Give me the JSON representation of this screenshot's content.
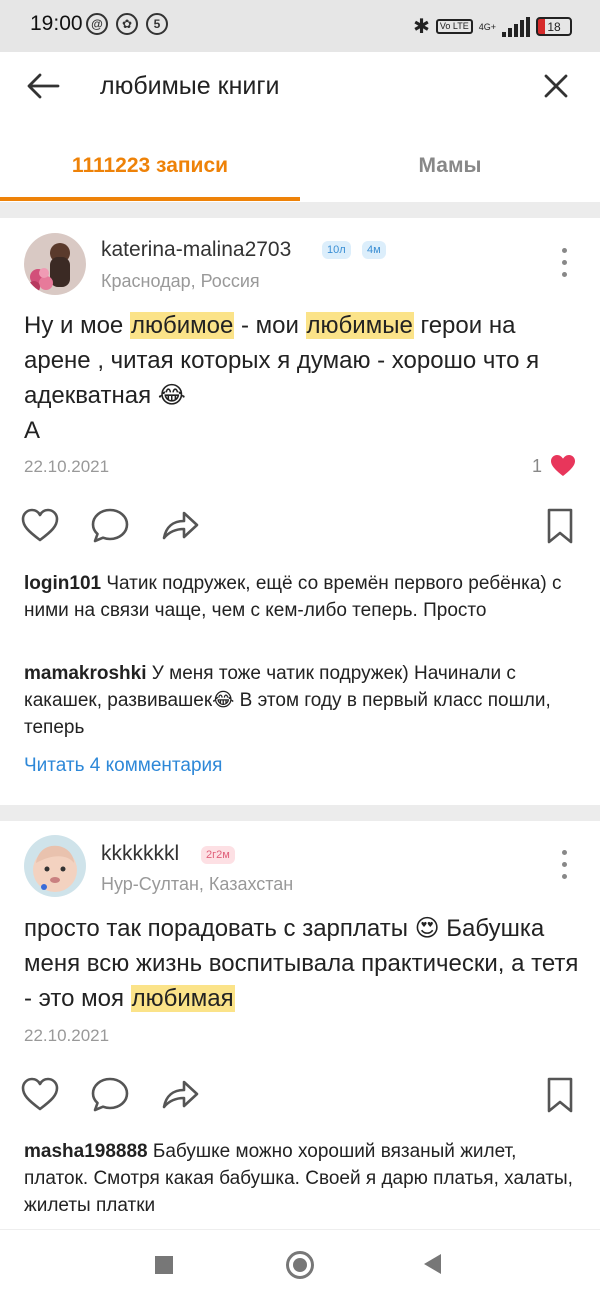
{
  "status": {
    "time": "19:00",
    "icons": [
      "at-icon",
      "gear-icon",
      "five-icon"
    ],
    "volte": "Vo LTE",
    "net": "4G+",
    "battery": "18"
  },
  "search": {
    "query": "любимые книги"
  },
  "tabs": [
    {
      "label": "1111223 записи",
      "active": true
    },
    {
      "label": "Мамы",
      "active": false
    }
  ],
  "posts": [
    {
      "author": "katerina-malina2703",
      "badges": [
        "10л",
        "4м"
      ],
      "location": "Краснодар, Россия",
      "text_parts": [
        "Ну и мое ",
        "любимое",
        " - мои ",
        "любимые",
        " герои на арене , читая которых я думаю - хорошо что я адекватная 😂",
        "А"
      ],
      "date": "22.10.2021",
      "likes": "1",
      "comments": [
        {
          "user": "login101",
          "text": " Чатик подружек, ещё со времён первого ребёнка) с ними на связи чаще, чем с кем-либо теперь. Просто"
        },
        {
          "user": "mamakroshki",
          "text": " У меня тоже чатик подружек) Начинали с какашек, развивашек😂 В этом году в первый класс пошли, теперь"
        }
      ],
      "read_more": "Читать 4 комментария"
    },
    {
      "author": "kkkkkkkl",
      "badges": [
        "2г2м"
      ],
      "location": "Нур-Султан, Казахстан",
      "text_parts": [
        "просто так порадовать с зарплаты 😍 Бабушка меня всю жизнь воспитывала практически, а тетя - это моя ",
        "любимая"
      ],
      "date": "22.10.2021",
      "comments": [
        {
          "user": "masha198888",
          "text": " Бабушке можно хороший вязаный жилет, платок. Смотря какая бабушка. Своей я дарю платья, халаты, жилеты платки"
        }
      ]
    }
  ],
  "colors": {
    "accent": "#ee8208",
    "highlight": "#fbe389",
    "link": "#2e88d8",
    "heart": "#e8365b"
  }
}
